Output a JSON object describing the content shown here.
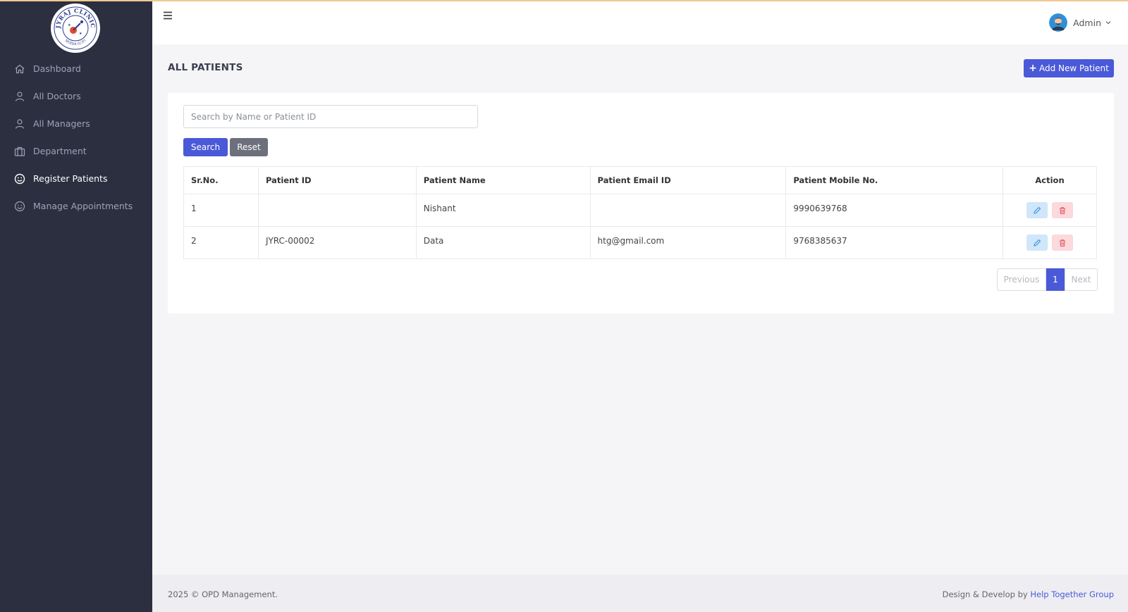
{
  "brand": {
    "logo_ring_text": "JYRAJ CLINIC",
    "logo_location_text": "NOIDA (U.P.)"
  },
  "sidebar": {
    "items": [
      {
        "label": "Dashboard",
        "icon": "home-icon"
      },
      {
        "label": "All Doctors",
        "icon": "user-icon"
      },
      {
        "label": "All Managers",
        "icon": "user-icon"
      },
      {
        "label": "Department",
        "icon": "briefcase-icon"
      },
      {
        "label": "Register Patients",
        "icon": "smile-icon",
        "active": true
      },
      {
        "label": "Manage Appointments",
        "icon": "smile-icon"
      }
    ]
  },
  "header": {
    "menu_icon": "hamburger-icon",
    "user_name": "Admin"
  },
  "page": {
    "title": "ALL PATIENTS",
    "add_button": "Add New Patient"
  },
  "search": {
    "placeholder": "Search by Name or Patient ID",
    "value": "",
    "search_label": "Search",
    "reset_label": "Reset"
  },
  "table": {
    "headers": [
      "Sr.No.",
      "Patient ID",
      "Patient Name",
      "Patient Email ID",
      "Patient Mobile No.",
      "Action"
    ],
    "rows": [
      {
        "sr": "1",
        "id": "",
        "name": "Nishant",
        "email": "",
        "mobile": "9990639768"
      },
      {
        "sr": "2",
        "id": "JYRC-00002",
        "name": "Data",
        "email": "htg@gmail.com",
        "mobile": "9768385637"
      }
    ]
  },
  "pagination": {
    "previous": "Previous",
    "current": "1",
    "next": "Next"
  },
  "footer": {
    "copyright": "2025 © OPD Management.",
    "credit_prefix": "Design & Develop by",
    "credit_link": "Help Together Group"
  },
  "colors": {
    "primary": "#4a59d8",
    "sidebar": "#2b2f40",
    "edit_bg": "#cfe6fb",
    "delete_bg": "#fbd9dc"
  }
}
